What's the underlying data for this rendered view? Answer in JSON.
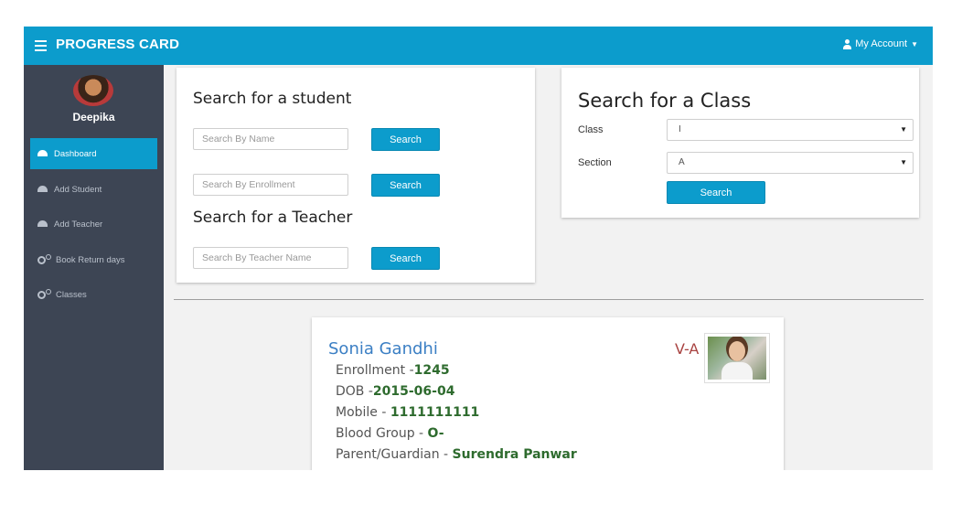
{
  "header": {
    "brand": "PROGRESS CARD",
    "account_label": "My Account"
  },
  "sidebar": {
    "username": "Deepika",
    "items": [
      {
        "label": "Dashboard",
        "icon": "dashboard-icon",
        "active": true
      },
      {
        "label": "Add Student",
        "icon": "dashboard-icon",
        "active": false
      },
      {
        "label": "Add Teacher",
        "icon": "dashboard-icon",
        "active": false
      },
      {
        "label": "Book Return days",
        "icon": "cogs-icon",
        "active": false
      },
      {
        "label": "Classes",
        "icon": "cogs-icon",
        "active": false
      }
    ]
  },
  "student_search": {
    "title": "Search for a student",
    "name_placeholder": "Search By Name",
    "enrollment_placeholder": "Search By Enrollment",
    "button_label": "Search"
  },
  "teacher_search": {
    "title": "Search for a Teacher",
    "name_placeholder": "Search By Teacher Name",
    "button_label": "Search"
  },
  "class_search": {
    "title": "Search for a Class",
    "class_label": "Class",
    "class_value": "I",
    "section_label": "Section",
    "section_value": "A",
    "button_label": "Search"
  },
  "student_card": {
    "name": "Sonia Gandhi",
    "class_section": "V-A",
    "enrollment_label": "Enrollment -",
    "enrollment": "1245",
    "dob_label": "DOB -",
    "dob": "2015-06-04",
    "mobile_label": "Mobile - ",
    "mobile": "1111111111",
    "blood_label": "Blood Group - ",
    "blood": "O-",
    "parent_label": "Parent/Guardian - ",
    "parent": "Surendra Panwar"
  },
  "colors": {
    "primary": "#0c9ccc",
    "sidebar": "#3d4554",
    "name": "#3b7fc4",
    "class_tag": "#a94442",
    "value": "#2e6b2e"
  }
}
